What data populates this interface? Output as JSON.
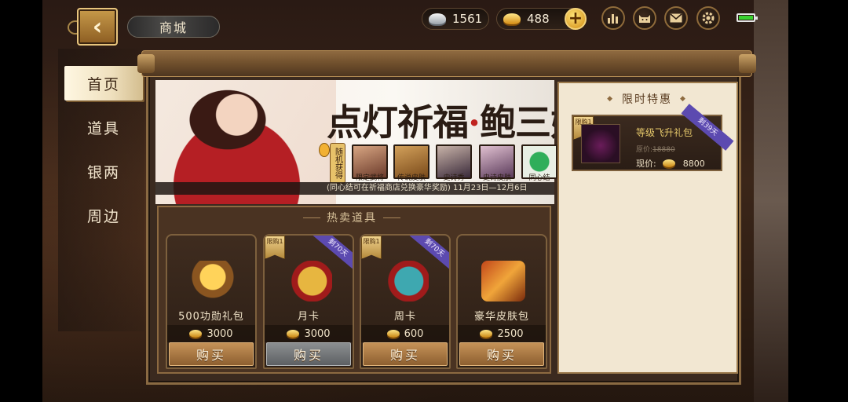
{
  "header": {
    "title": "商城",
    "back_icon": "‹",
    "silver": "1561",
    "gold": "488",
    "plus": "+",
    "icons": [
      "ranking-icon",
      "cat-icon",
      "mail-icon",
      "settings-icon"
    ]
  },
  "sidebar": {
    "items": [
      {
        "label": "首页",
        "active": true
      },
      {
        "label": "道具",
        "active": false
      },
      {
        "label": "银两",
        "active": false
      },
      {
        "label": "周边",
        "active": false
      }
    ]
  },
  "banner": {
    "title_a": "点灯祈福",
    "title_dot": "·",
    "title_b": "鲍三娘",
    "random_tag": "随机获得",
    "rewards": [
      "限定武将",
      "传说皮肤",
      "史诗秀",
      "史诗皮肤",
      "同心结"
    ],
    "footer": "(同心结可在祈福商店兑换豪华奖励) 11月23日—12月6日"
  },
  "hot": {
    "title": "热卖道具",
    "limit_badge": "限购1",
    "items": [
      {
        "name": "500功勋礼包",
        "price": "3000",
        "buy": "购买",
        "limited": false,
        "ribbon": "",
        "disabled": false
      },
      {
        "name": "月卡",
        "price": "3000",
        "buy": "购买",
        "limited": true,
        "ribbon": "剩70天",
        "disabled": true
      },
      {
        "name": "周卡",
        "price": "600",
        "buy": "购买",
        "limited": true,
        "ribbon": "剩70天",
        "disabled": false
      },
      {
        "name": "豪华皮肤包",
        "price": "2500",
        "buy": "购买",
        "limited": false,
        "ribbon": "",
        "disabled": false
      }
    ]
  },
  "offer": {
    "title": "限时特惠",
    "item_name": "等级飞升礼包",
    "orig_label": "原价:",
    "orig_price": "18880",
    "now_label": "现价:",
    "now_price": "8800",
    "limit_badge": "限购1",
    "ribbon": "剩39天"
  },
  "colors": {
    "accent_gold": "#e5c76a",
    "buy_button": "#a97744",
    "ribbon": "#5c4ab0",
    "battery": "#39d12f"
  }
}
